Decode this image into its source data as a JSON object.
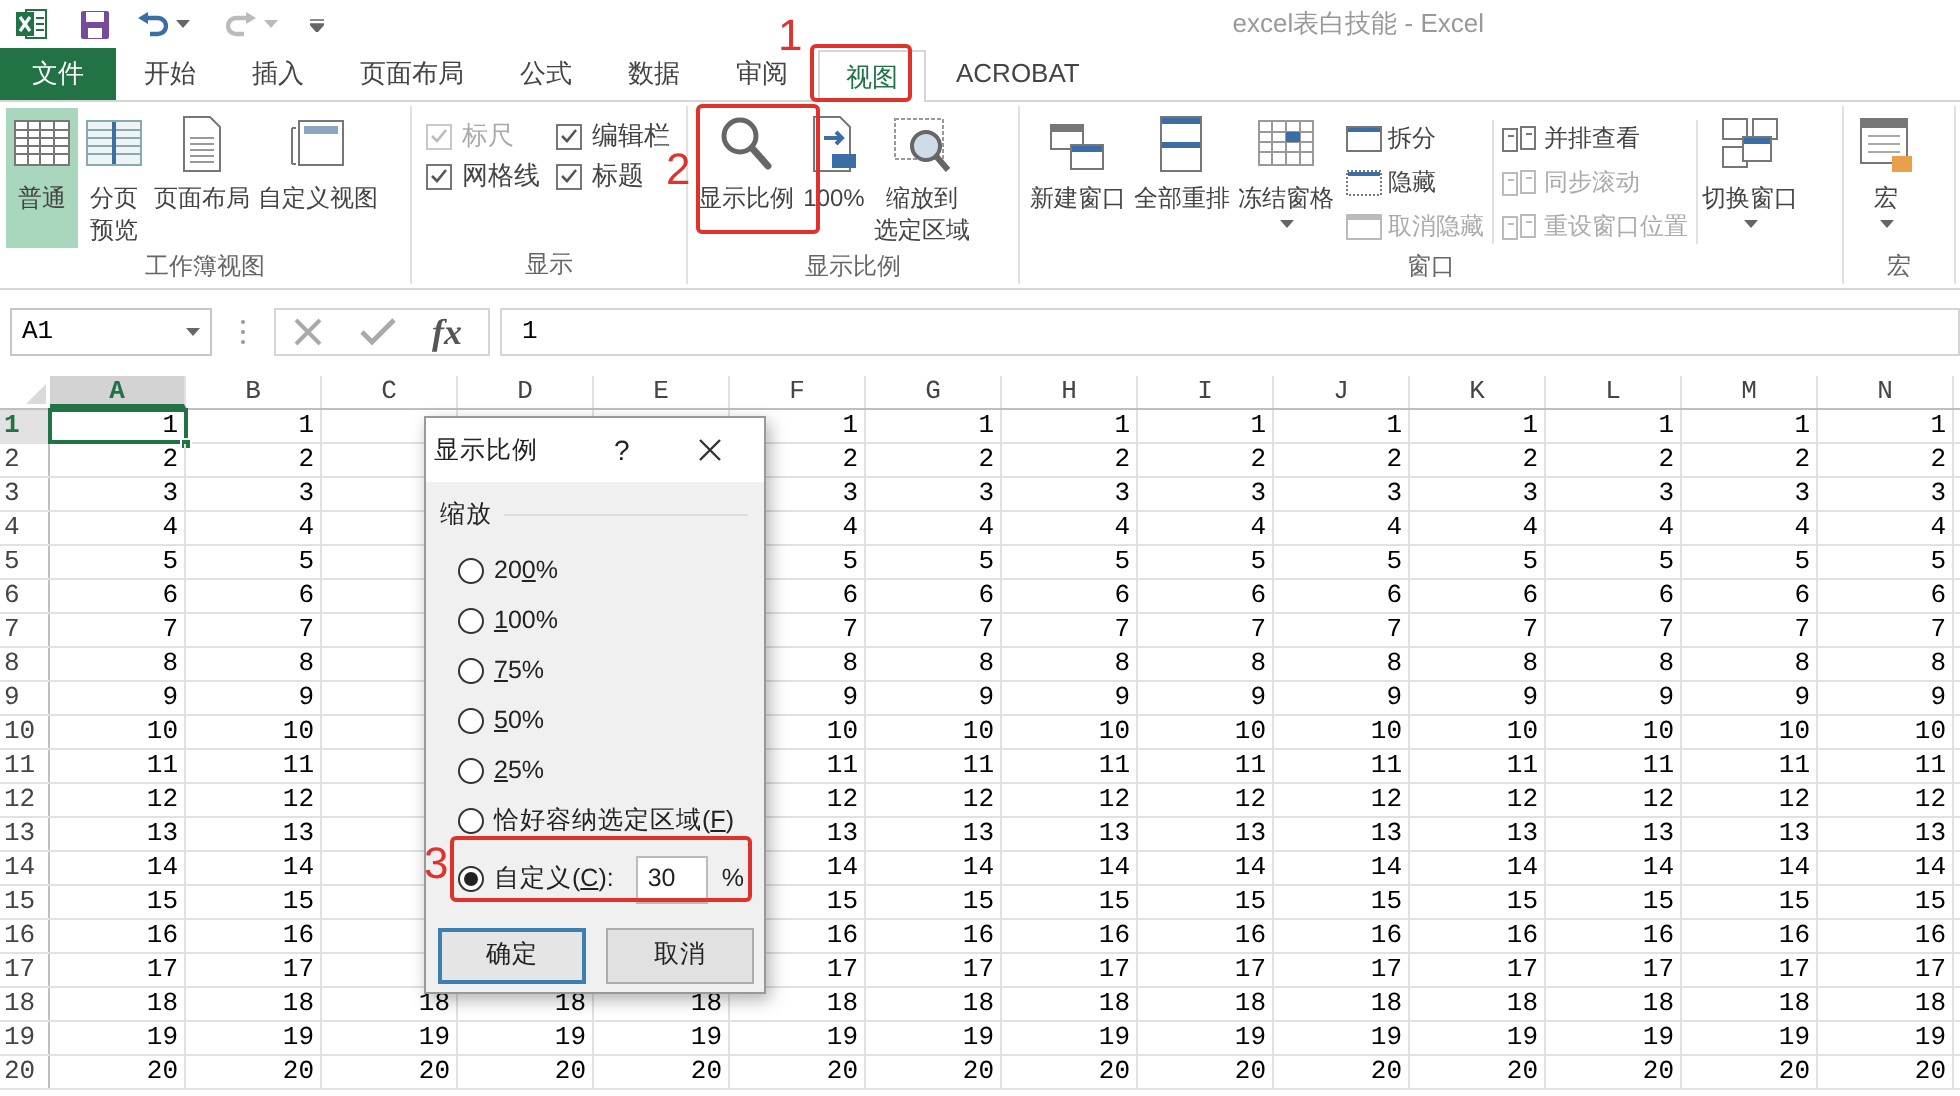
{
  "window": {
    "title": "excel表白技能 - Excel"
  },
  "tabs": [
    {
      "label": "文件",
      "kind": "file",
      "selected": false
    },
    {
      "label": "开始",
      "kind": "tab",
      "selected": false
    },
    {
      "label": "插入",
      "kind": "tab",
      "selected": false
    },
    {
      "label": "页面布局",
      "kind": "tab",
      "selected": false
    },
    {
      "label": "公式",
      "kind": "tab",
      "selected": false
    },
    {
      "label": "数据",
      "kind": "tab",
      "selected": false
    },
    {
      "label": "审阅",
      "kind": "tab",
      "selected": false
    },
    {
      "label": "视图",
      "kind": "tab",
      "selected": true
    },
    {
      "label": "ACROBAT",
      "kind": "tab",
      "selected": false
    }
  ],
  "ribbon": {
    "groups": [
      {
        "label": "工作簿视图",
        "items": [
          {
            "kind": "large",
            "lines": [
              "普通"
            ],
            "selected": true,
            "dropdown": false
          },
          {
            "kind": "large",
            "lines": [
              "分页",
              "预览"
            ],
            "selected": false,
            "dropdown": false
          },
          {
            "kind": "large",
            "lines": [
              "页面布局"
            ],
            "selected": false,
            "dropdown": false
          },
          {
            "kind": "large",
            "lines": [
              "自定义视图"
            ],
            "selected": false,
            "dropdown": false
          }
        ]
      },
      {
        "label": "显示",
        "items": [
          {
            "kind": "stack",
            "items": [
              {
                "kind": "check",
                "label": "标尺",
                "checked": true,
                "disabled": true
              },
              {
                "kind": "check",
                "label": "网格线",
                "checked": true,
                "disabled": false
              }
            ]
          },
          {
            "kind": "stack",
            "items": [
              {
                "kind": "check",
                "label": "编辑栏",
                "checked": true,
                "disabled": false
              },
              {
                "kind": "check",
                "label": "标题",
                "checked": true,
                "disabled": false
              }
            ]
          }
        ]
      },
      {
        "label": "显示比例",
        "items": [
          {
            "kind": "large",
            "lines": [
              "显示比例"
            ],
            "selected": false,
            "dropdown": false
          },
          {
            "kind": "large",
            "lines": [
              "100%"
            ],
            "selected": false,
            "dropdown": false
          },
          {
            "kind": "large",
            "lines": [
              "缩放到",
              "选定区域"
            ],
            "selected": false,
            "dropdown": false
          }
        ]
      },
      {
        "label": "窗口",
        "items": [
          {
            "kind": "large",
            "lines": [
              "新建窗口"
            ],
            "selected": false,
            "dropdown": false
          },
          {
            "kind": "large",
            "lines": [
              "全部重排"
            ],
            "selected": false,
            "dropdown": false
          },
          {
            "kind": "large",
            "lines": [
              "冻结窗格"
            ],
            "selected": false,
            "dropdown": true
          },
          {
            "kind": "stack",
            "items": [
              {
                "kind": "small",
                "label": "拆分",
                "disabled": false
              },
              {
                "kind": "small",
                "label": "隐藏",
                "disabled": false
              },
              {
                "kind": "small",
                "label": "取消隐藏",
                "disabled": true
              }
            ]
          },
          {
            "kind": "stack",
            "items": [
              {
                "kind": "small",
                "label": "并排查看",
                "disabled": false
              },
              {
                "kind": "small",
                "label": "同步滚动",
                "disabled": true
              },
              {
                "kind": "small",
                "label": "重设窗口位置",
                "disabled": true
              }
            ]
          },
          {
            "kind": "large",
            "lines": [
              "切换窗口"
            ],
            "selected": false,
            "dropdown": true
          }
        ]
      },
      {
        "label": "宏",
        "items": [
          {
            "kind": "large",
            "lines": [
              "宏"
            ],
            "selected": false,
            "dropdown": true
          }
        ]
      }
    ]
  },
  "formula_bar": {
    "name_box": "A1",
    "function_label": "fx",
    "value": "1"
  },
  "grid": {
    "columns": [
      {
        "label": "A",
        "selected": true
      },
      {
        "label": "B",
        "selected": false
      },
      {
        "label": "C",
        "selected": false
      },
      {
        "label": "D",
        "selected": false
      },
      {
        "label": "E",
        "selected": false
      },
      {
        "label": "F",
        "selected": false
      },
      {
        "label": "G",
        "selected": false
      },
      {
        "label": "H",
        "selected": false
      },
      {
        "label": "I",
        "selected": false
      },
      {
        "label": "J",
        "selected": false
      },
      {
        "label": "K",
        "selected": false
      },
      {
        "label": "L",
        "selected": false
      },
      {
        "label": "M",
        "selected": false
      },
      {
        "label": "N",
        "selected": false
      }
    ],
    "rows": [
      {
        "label": "1",
        "selected": true,
        "cells": [
          "1",
          "1",
          null,
          null,
          null,
          "1",
          "1",
          "1",
          "1",
          "1",
          "1",
          "1",
          "1",
          "1"
        ]
      },
      {
        "label": "2",
        "selected": false,
        "cells": [
          "2",
          "2",
          null,
          null,
          null,
          "2",
          "2",
          "2",
          "2",
          "2",
          "2",
          "2",
          "2",
          "2"
        ]
      },
      {
        "label": "3",
        "selected": false,
        "cells": [
          "3",
          "3",
          null,
          null,
          null,
          "3",
          "3",
          "3",
          "3",
          "3",
          "3",
          "3",
          "3",
          "3"
        ]
      },
      {
        "label": "4",
        "selected": false,
        "cells": [
          "4",
          "4",
          null,
          null,
          null,
          "4",
          "4",
          "4",
          "4",
          "4",
          "4",
          "4",
          "4",
          "4"
        ]
      },
      {
        "label": "5",
        "selected": false,
        "cells": [
          "5",
          "5",
          null,
          null,
          null,
          "5",
          "5",
          "5",
          "5",
          "5",
          "5",
          "5",
          "5",
          "5"
        ]
      },
      {
        "label": "6",
        "selected": false,
        "cells": [
          "6",
          "6",
          null,
          null,
          null,
          "6",
          "6",
          "6",
          "6",
          "6",
          "6",
          "6",
          "6",
          "6"
        ]
      },
      {
        "label": "7",
        "selected": false,
        "cells": [
          "7",
          "7",
          null,
          null,
          null,
          "7",
          "7",
          "7",
          "7",
          "7",
          "7",
          "7",
          "7",
          "7"
        ]
      },
      {
        "label": "8",
        "selected": false,
        "cells": [
          "8",
          "8",
          null,
          null,
          null,
          "8",
          "8",
          "8",
          "8",
          "8",
          "8",
          "8",
          "8",
          "8"
        ]
      },
      {
        "label": "9",
        "selected": false,
        "cells": [
          "9",
          "9",
          null,
          null,
          null,
          "9",
          "9",
          "9",
          "9",
          "9",
          "9",
          "9",
          "9",
          "9"
        ]
      },
      {
        "label": "10",
        "selected": false,
        "cells": [
          "10",
          "10",
          null,
          null,
          null,
          "10",
          "10",
          "10",
          "10",
          "10",
          "10",
          "10",
          "10",
          "10"
        ]
      },
      {
        "label": "11",
        "selected": false,
        "cells": [
          "11",
          "11",
          null,
          null,
          null,
          "11",
          "11",
          "11",
          "11",
          "11",
          "11",
          "11",
          "11",
          "11"
        ]
      },
      {
        "label": "12",
        "selected": false,
        "cells": [
          "12",
          "12",
          null,
          null,
          null,
          "12",
          "12",
          "12",
          "12",
          "12",
          "12",
          "12",
          "12",
          "12"
        ]
      },
      {
        "label": "13",
        "selected": false,
        "cells": [
          "13",
          "13",
          null,
          null,
          null,
          "13",
          "13",
          "13",
          "13",
          "13",
          "13",
          "13",
          "13",
          "13"
        ]
      },
      {
        "label": "14",
        "selected": false,
        "cells": [
          "14",
          "14",
          null,
          null,
          null,
          "14",
          "14",
          "14",
          "14",
          "14",
          "14",
          "14",
          "14",
          "14"
        ]
      },
      {
        "label": "15",
        "selected": false,
        "cells": [
          "15",
          "15",
          null,
          null,
          null,
          "15",
          "15",
          "15",
          "15",
          "15",
          "15",
          "15",
          "15",
          "15"
        ]
      },
      {
        "label": "16",
        "selected": false,
        "cells": [
          "16",
          "16",
          null,
          null,
          null,
          "16",
          "16",
          "16",
          "16",
          "16",
          "16",
          "16",
          "16",
          "16"
        ]
      },
      {
        "label": "17",
        "selected": false,
        "cells": [
          "17",
          "17",
          null,
          null,
          null,
          "17",
          "17",
          "17",
          "17",
          "17",
          "17",
          "17",
          "17",
          "17"
        ]
      },
      {
        "label": "18",
        "selected": false,
        "cells": [
          "18",
          "18",
          "18",
          "18",
          "18",
          "18",
          "18",
          "18",
          "18",
          "18",
          "18",
          "18",
          "18",
          "18"
        ]
      },
      {
        "label": "19",
        "selected": false,
        "cells": [
          "19",
          "19",
          "19",
          "19",
          "19",
          "19",
          "19",
          "19",
          "19",
          "19",
          "19",
          "19",
          "19",
          "19"
        ]
      },
      {
        "label": "20",
        "selected": false,
        "cells": [
          "20",
          "20",
          "20",
          "20",
          "20",
          "20",
          "20",
          "20",
          "20",
          "20",
          "20",
          "20",
          "20",
          "20"
        ]
      }
    ]
  },
  "dialog": {
    "title": "显示比例",
    "help": "?",
    "group_label": "缩放",
    "options": [
      {
        "kind": "radio",
        "pre": "20",
        "key": "0",
        "post": "%",
        "selected": false
      },
      {
        "kind": "radio",
        "key": "1",
        "post": "00%",
        "selected": false
      },
      {
        "kind": "radio",
        "key": "7",
        "post": "5%",
        "selected": false
      },
      {
        "kind": "radio",
        "key": "5",
        "post": "0%",
        "selected": false
      },
      {
        "kind": "radio",
        "key": "2",
        "post": "5%",
        "selected": false
      },
      {
        "kind": "radio",
        "pre": "恰好容纳选定区域(",
        "key": "F",
        "post": ")",
        "selected": false
      },
      {
        "kind": "custom",
        "pre": "自定义(",
        "key": "C",
        "post": "):",
        "selected": true,
        "value": "30",
        "unit": "%"
      }
    ],
    "buttons": [
      {
        "label": "确定",
        "default": true
      },
      {
        "label": "取消",
        "default": false
      }
    ]
  },
  "annotations": [
    {
      "label": "1"
    },
    {
      "label": "2"
    },
    {
      "label": "3"
    }
  ]
}
